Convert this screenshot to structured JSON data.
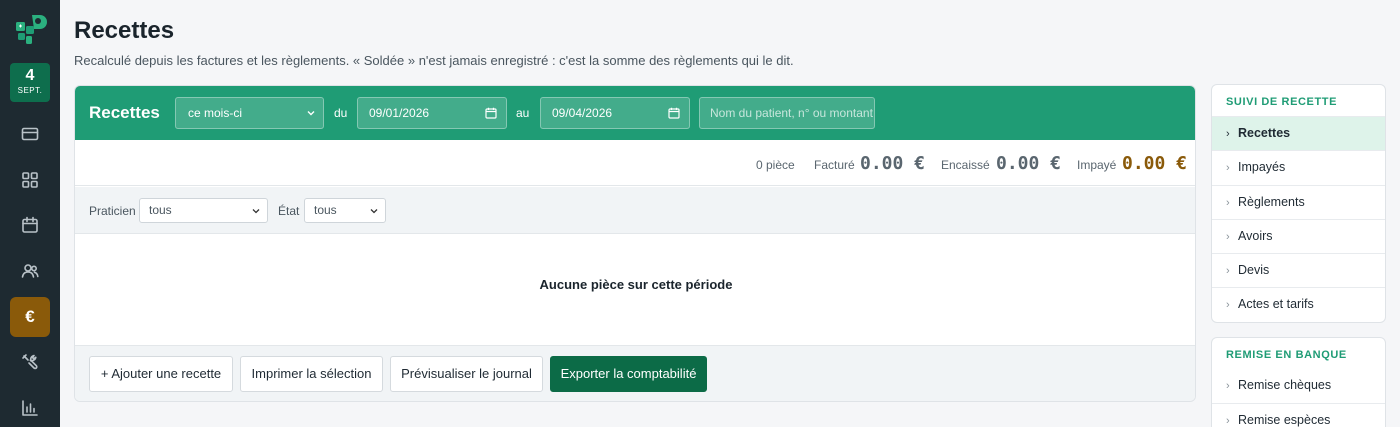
{
  "sidebar": {
    "date": {
      "day": "4",
      "month": "SEPT."
    },
    "active_icon_glyph": "€",
    "icons": [
      "card-icon",
      "grid-icon",
      "calendar-icon",
      "users-icon",
      "euro-icon",
      "tools-icon",
      "chart-icon"
    ]
  },
  "page": {
    "title": "Recettes",
    "subtitle": "Recalculé depuis les factures et les règlements. « Soldée » n'est jamais enregistré : c'est la somme des règlements qui le dit."
  },
  "card": {
    "title": "Recettes",
    "period_select": "ce mois-ci",
    "from_label": "du",
    "from_date": "09/01/2026",
    "to_label": "au",
    "to_date": "09/04/2026",
    "search_placeholder": "Nom du patient, n° ou montant"
  },
  "summary": {
    "count": "0 pièce",
    "billed_label": "Facturé",
    "billed_value": "0.00 €",
    "cashed_label": "Encaissé",
    "cashed_value": "0.00 €",
    "unpaid_label": "Impayé",
    "unpaid_value": "0.00 €"
  },
  "filters": {
    "practitioner_label": "Praticien",
    "practitioner_value": "tous",
    "state_label": "État",
    "state_value": "tous"
  },
  "empty_message": "Aucune pièce sur cette période",
  "actions": {
    "add": "+ Ajouter une recette",
    "print": "Imprimer la sélection",
    "preview": "Prévisualiser le journal",
    "export": "Exporter la comptabilité"
  },
  "right_panel": {
    "tracking": {
      "title": "SUIVI DE RECETTE",
      "items": [
        "Recettes",
        "Impayés",
        "Règlements",
        "Avoirs",
        "Devis",
        "Actes et tarifs"
      ]
    },
    "bank": {
      "title": "REMISE EN BANQUE",
      "items": [
        "Remise chèques",
        "Remise espèces"
      ]
    }
  },
  "colors": {
    "brand_green": "#1f9c75",
    "dark_green": "#0c6b47",
    "accent_brown": "#8a5a0a",
    "sidebar_bg": "#1e2a31"
  }
}
